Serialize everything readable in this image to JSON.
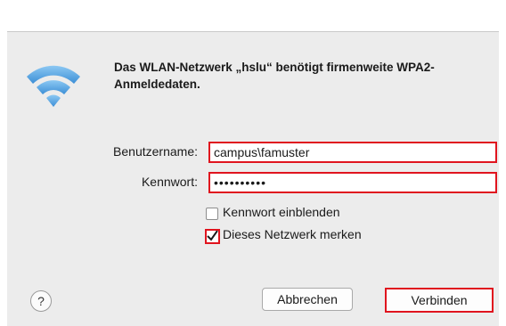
{
  "dialog": {
    "message": "Das WLAN-Netzwerk „hslu“ benötigt firmenweite WPA2-Anmeldedaten.",
    "icon": "wifi-icon",
    "username": {
      "label": "Benutzername:",
      "value": "campus\\famuster"
    },
    "password": {
      "label": "Kennwort:",
      "masked_value": "••••••••••"
    },
    "checkboxes": [
      {
        "label": "Kennwort einblenden",
        "checked": false
      },
      {
        "label": "Dieses Netzwerk merken",
        "checked": true
      }
    ],
    "help_label": "?",
    "cancel_label": "Abbrechen",
    "connect_label": "Verbinden",
    "highlight_color": "#e0141e",
    "wifi_color": "#5aa8e6"
  }
}
